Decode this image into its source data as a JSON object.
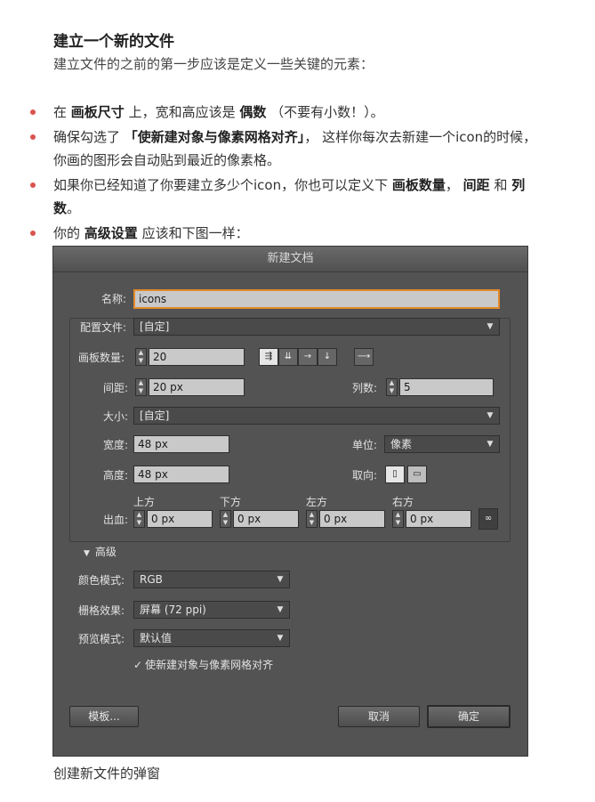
{
  "article": {
    "heading": "建立一个新的文件",
    "intro": "建立文件的之前的第一步应该是定义一些关键的元素：",
    "bullets": [
      {
        "p1": "在 ",
        "b1": "画板尺寸",
        "p2": " 上，宽和高应该是 ",
        "b2": "偶数",
        "p3": " （不要有小数！）。"
      },
      {
        "p1": "确保勾选了 ",
        "b1": "「使新建对象与像素网格对齐」",
        "p2": "， 这样你每次去新建一个icon的时候，你画的图形会自动贴到最近的像素格。"
      },
      {
        "p1": "如果你已经知道了你要建立多少个icon，你也可以定义下 ",
        "b1": "画板数量",
        "p2": "， ",
        "b2": "间距",
        "p3": " 和 ",
        "b3": "列数",
        "p4": "。"
      },
      {
        "p1": "你的 ",
        "b1": "高级设置",
        "p2": " 应该和下图一样："
      }
    ],
    "caption": "创建新文件的弹窗"
  },
  "dialog": {
    "title": "新建文档",
    "name_label": "名称:",
    "name_value": "icons",
    "profile_label": "配置文件:",
    "profile_value": "[自定]",
    "artboards_label": "画板数量:",
    "artboards_value": "20",
    "spacing_label": "间距:",
    "spacing_value": "20 px",
    "columns_label": "列数:",
    "columns_value": "5",
    "size_label": "大小:",
    "size_value": "[自定]",
    "width_label": "宽度:",
    "width_value": "48 px",
    "units_label": "单位:",
    "units_value": "像素",
    "height_label": "高度:",
    "height_value": "48 px",
    "orientation_label": "取向:",
    "bleed_label": "出血:",
    "bleed": [
      {
        "label": "上方",
        "value": "0 px"
      },
      {
        "label": "下方",
        "value": "0 px"
      },
      {
        "label": "左方",
        "value": "0 px"
      },
      {
        "label": "右方",
        "value": "0 px"
      }
    ],
    "advanced_label": "高级",
    "color_mode_label": "颜色模式:",
    "color_mode_value": "RGB",
    "raster_label": "栅格效果:",
    "raster_value": "屏幕 (72 ppi)",
    "preview_label": "预览模式:",
    "preview_value": "默认值",
    "align_checkbox": "使新建对象与像素网格对齐",
    "templates_button": "模板...",
    "cancel_button": "取消",
    "ok_button": "确定"
  },
  "colors": {
    "bullet": "#d9534f",
    "dialog_bg": "#535353",
    "name_focus": "#e38a2b"
  }
}
